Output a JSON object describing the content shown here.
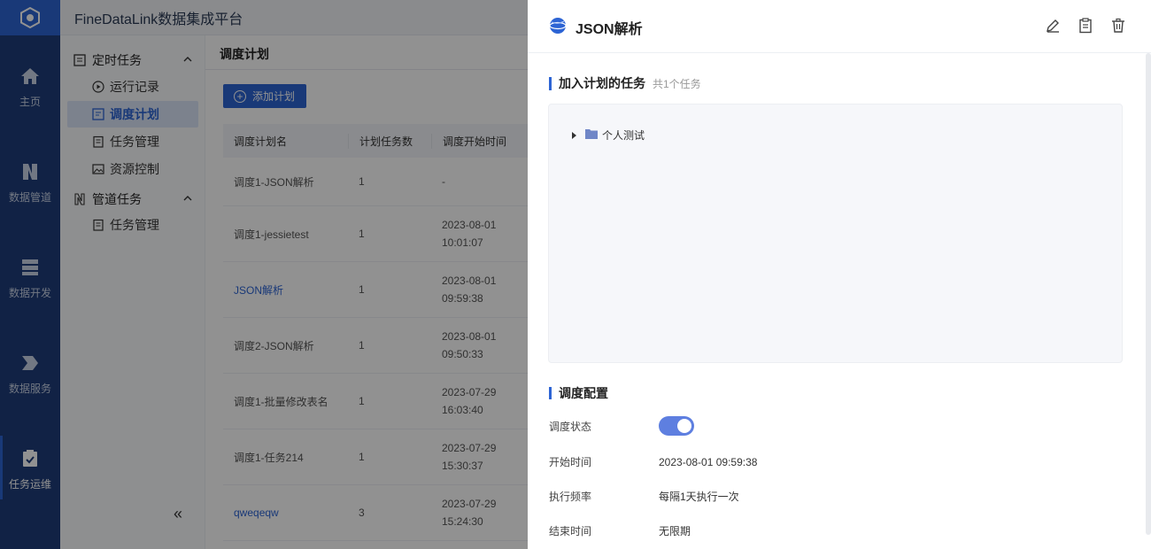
{
  "app": {
    "title": "FineDataLink数据集成平台"
  },
  "rail": {
    "items": [
      {
        "label": "主页",
        "icon": "home-icon"
      },
      {
        "label": "数据管道",
        "icon": "pipeline-icon"
      },
      {
        "label": "数据开发",
        "icon": "dev-icon"
      },
      {
        "label": "数据服务",
        "icon": "service-icon"
      },
      {
        "label": "任务运维",
        "icon": "task-ops-icon"
      }
    ]
  },
  "subnav": {
    "group1": "定时任务",
    "group1_items": [
      "运行记录",
      "调度计划",
      "任务管理",
      "资源控制"
    ],
    "group2": "管道任务",
    "group2_items": [
      "任务管理"
    ],
    "collapse": "«"
  },
  "main": {
    "title": "调度计划",
    "add_button": "添加计划",
    "columns": [
      "调度计划名",
      "计划任务数",
      "调度开始时间"
    ],
    "rows": [
      {
        "name": "调度1-JSON解析",
        "count": "1",
        "date": "-",
        "time": "",
        "link": false
      },
      {
        "name": "调度1-jessietest",
        "count": "1",
        "date": "2023-08-01",
        "time": "10:01:07",
        "link": false
      },
      {
        "name": "JSON解析",
        "count": "1",
        "date": "2023-08-01",
        "time": "09:59:38",
        "link": true
      },
      {
        "name": "调度2-JSON解析",
        "count": "1",
        "date": "2023-08-01",
        "time": "09:50:33",
        "link": false
      },
      {
        "name": "调度1-批量修改表名",
        "count": "1",
        "date": "2023-07-29",
        "time": "16:03:40",
        "link": false
      },
      {
        "name": "调度1-任务214",
        "count": "1",
        "date": "2023-07-29",
        "time": "15:30:37",
        "link": false
      },
      {
        "name": "qweqeqw",
        "count": "3",
        "date": "2023-07-29",
        "time": "15:24:30",
        "link": true
      }
    ]
  },
  "drawer": {
    "title": "JSON解析",
    "tasks_section": "加入计划的任务",
    "tasks_count": "共1个任务",
    "tree_node": "个人测试",
    "config_section": "调度配置",
    "config": {
      "status_label": "调度状态",
      "start_label": "开始时间",
      "start_value": "2023-08-01 09:59:38",
      "freq_label": "执行频率",
      "freq_value": "每隔1天执行一次",
      "end_label": "结束时间",
      "end_value": "无限期"
    }
  },
  "colors": {
    "primary": "#2d64d4",
    "rail": "#1f3d7a",
    "toggle": "#5e7fe0"
  }
}
